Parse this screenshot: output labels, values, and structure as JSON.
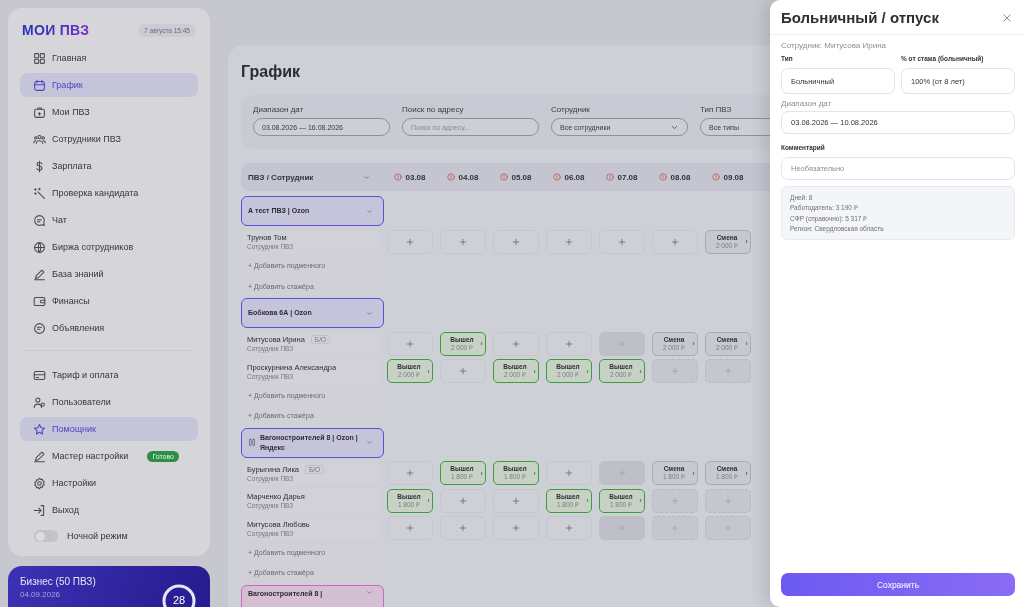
{
  "sidebar": {
    "logo": "МОИ ПВЗ",
    "datetime": "7 августа 15:45",
    "items": [
      {
        "label": "Главная",
        "selected": false
      },
      {
        "label": "График",
        "selected": true
      },
      {
        "label": "Мои ПВЗ",
        "selected": false
      },
      {
        "label": "Сотрудники ПВЗ",
        "selected": false
      },
      {
        "label": "Зарплата",
        "selected": false
      },
      {
        "label": "Проверка кандидата",
        "selected": false
      },
      {
        "label": "Чат",
        "selected": false
      },
      {
        "label": "Биржа сотрудников",
        "selected": false
      },
      {
        "label": "База знаний",
        "selected": false
      },
      {
        "label": "Финансы",
        "selected": false
      },
      {
        "label": "Объявления",
        "selected": false
      }
    ],
    "secondary_items": [
      {
        "label": "Тариф и оплата",
        "selected": false
      },
      {
        "label": "Пользователи",
        "selected": false
      },
      {
        "label": "Помощник",
        "selected": true
      },
      {
        "label": "Мастер настройки",
        "selected": false,
        "badge": "Готово"
      },
      {
        "label": "Настройки",
        "selected": false
      },
      {
        "label": "Выход",
        "selected": false
      }
    ],
    "night_mode": {
      "label": "Ночной режим",
      "on": false
    }
  },
  "plan_card": {
    "title": "Бизнес (50 ПВЗ)",
    "date": "04.09.2026",
    "days": "28"
  },
  "page": {
    "title": "График"
  },
  "filters": [
    {
      "label": "Диапазон дат",
      "kind": "text",
      "value": "03.08.2026 — 16.08.2026"
    },
    {
      "label": "Поиск по адресу",
      "kind": "text",
      "placeholder": "Поиск по адресу..."
    },
    {
      "label": "Сотрудник",
      "kind": "select",
      "value": "Все сотрудники"
    },
    {
      "label": "Тип ПВЗ",
      "kind": "select",
      "value": "Все типы"
    }
  ],
  "schedule": {
    "corner": "ПВЗ / Сотрудник",
    "dates": [
      "03.08",
      "04.08",
      "05.08",
      "06.08",
      "07.08",
      "08.08",
      "09.08"
    ],
    "groups": [
      {
        "title": "А тест ПВЗ | Ozon",
        "color": "#5b4fd6",
        "linked": false,
        "employees": [
          {
            "name": "Трунов Том",
            "role": "Сотрудник ПВЗ",
            "cells": [
              {
                "kind": "add"
              },
              {
                "kind": "add"
              },
              {
                "kind": "add"
              },
              {
                "kind": "add"
              },
              {
                "kind": "add"
              },
              {
                "kind": "add"
              },
              {
                "kind": "planned",
                "status": "Смена",
                "amount": "2 000 ₽"
              }
            ]
          }
        ],
        "actions": [
          "+ Добавить подменного",
          "+ Добавить стажёра"
        ]
      },
      {
        "title": "Бобкова 6А | Ozon",
        "color": "#5b4fd6",
        "linked": false,
        "employees": [
          {
            "name": "Митусова Ирина",
            "badge": "Б/О",
            "role": "Сотрудник ПВЗ",
            "cells": [
              {
                "kind": "add"
              },
              {
                "kind": "worked",
                "status": "Вышел",
                "amount": "2 000 ₽"
              },
              {
                "kind": "add"
              },
              {
                "kind": "add"
              },
              {
                "kind": "today"
              },
              {
                "kind": "planned",
                "status": "Смена",
                "amount": "2 000 ₽"
              },
              {
                "kind": "planned",
                "status": "Смена",
                "amount": "2 000 ₽"
              }
            ]
          },
          {
            "name": "Проскурнина Александра",
            "role": "Сотрудник ПВЗ",
            "cells": [
              {
                "kind": "worked",
                "status": "Вышел",
                "amount": "2 000 ₽"
              },
              {
                "kind": "add"
              },
              {
                "kind": "worked",
                "status": "Вышел",
                "amount": "2 000 ₽"
              },
              {
                "kind": "worked",
                "status": "Вышел",
                "amount": "2 000 ₽"
              },
              {
                "kind": "worked",
                "status": "Вышел",
                "amount": "2 000 ₽"
              },
              {
                "kind": "future"
              },
              {
                "kind": "future"
              }
            ]
          }
        ],
        "actions": [
          "+ Добавить подменного",
          "+ Добавить стажёра"
        ]
      },
      {
        "title": "Вагоностроителей 8 | Ozon | Яндекс",
        "color": "#5b4fd6",
        "linked": true,
        "employees": [
          {
            "name": "Бурыгина Лика",
            "badge": "Б/О",
            "role": "Сотрудник ПВЗ",
            "cells": [
              {
                "kind": "add"
              },
              {
                "kind": "worked",
                "status": "Вышел",
                "amount": "1 800 ₽"
              },
              {
                "kind": "worked",
                "status": "Вышел",
                "amount": "1 800 ₽"
              },
              {
                "kind": "add"
              },
              {
                "kind": "today"
              },
              {
                "kind": "planned",
                "status": "Смена",
                "amount": "1 800 ₽"
              },
              {
                "kind": "planned",
                "status": "Смена",
                "amount": "1 800 ₽"
              }
            ]
          },
          {
            "name": "Марченко Дарья",
            "role": "Сотрудник ПВЗ",
            "cells": [
              {
                "kind": "worked",
                "status": "Вышел",
                "amount": "1 800 ₽"
              },
              {
                "kind": "add"
              },
              {
                "kind": "add"
              },
              {
                "kind": "worked",
                "status": "Вышел",
                "amount": "1 800 ₽"
              },
              {
                "kind": "worked",
                "status": "Вышел",
                "amount": "1 800 ₽"
              },
              {
                "kind": "future"
              },
              {
                "kind": "future"
              }
            ]
          },
          {
            "name": "Митусова Любовь",
            "role": "Сотрудник ПВЗ",
            "cells": [
              {
                "kind": "add"
              },
              {
                "kind": "add"
              },
              {
                "kind": "add"
              },
              {
                "kind": "add"
              },
              {
                "kind": "today"
              },
              {
                "kind": "future"
              },
              {
                "kind": "future"
              }
            ]
          }
        ],
        "actions": [
          "+ Добавить подменного",
          "+ Добавить стажёра"
        ]
      },
      {
        "title": "Вагоностроителей 8 |",
        "color": "#d064c8",
        "linked": false
      }
    ]
  },
  "drawer": {
    "title": "Больничный / отпуск",
    "employee": "Сотрудник: Митусова Ирина",
    "type_label": "Тип",
    "type_value": "Больничный",
    "percent_label": "% от стажа (больничный)",
    "percent_value": "100% (от 8 лет)",
    "range_label": "Диапазон дат",
    "range_value": "03.08.2026 — 10.08.2026",
    "comment_label": "Комментарий",
    "comment_placeholder": "Необязательно",
    "info": [
      "Дней: 8",
      "Работодатель: 3 190 ₽",
      "СФР (справочно): 5 317 ₽",
      "Регион: Свердловская область"
    ],
    "save": "Сохранить"
  }
}
